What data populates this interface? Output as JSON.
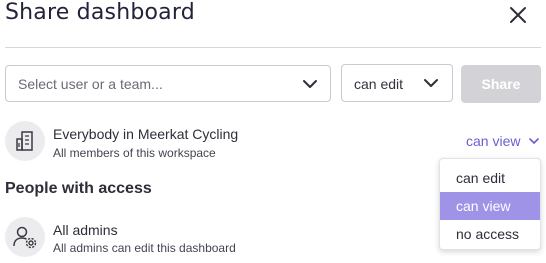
{
  "dialog": {
    "title": "Share dashboard"
  },
  "share_form": {
    "user_placeholder": "Select user or a team...",
    "permission_value": "can edit",
    "share_label": "Share"
  },
  "workspace_row": {
    "icon": "building-icon",
    "name": "Everybody in Meerkat Cycling",
    "subtitle": "All members of this workspace",
    "permission": "can view"
  },
  "people_section": {
    "title": "People with access"
  },
  "admins_row": {
    "icon": "user-settings-icon",
    "name": "All admins",
    "subtitle": "All admins can edit this dashboard"
  },
  "permission_dropdown": {
    "options": [
      "can edit",
      "can view",
      "no access"
    ],
    "selected": "can view"
  },
  "colors": {
    "accent": "#6a5fd0",
    "selected_bg": "#9f93e8",
    "disabled_button": "#d3d3d7"
  }
}
